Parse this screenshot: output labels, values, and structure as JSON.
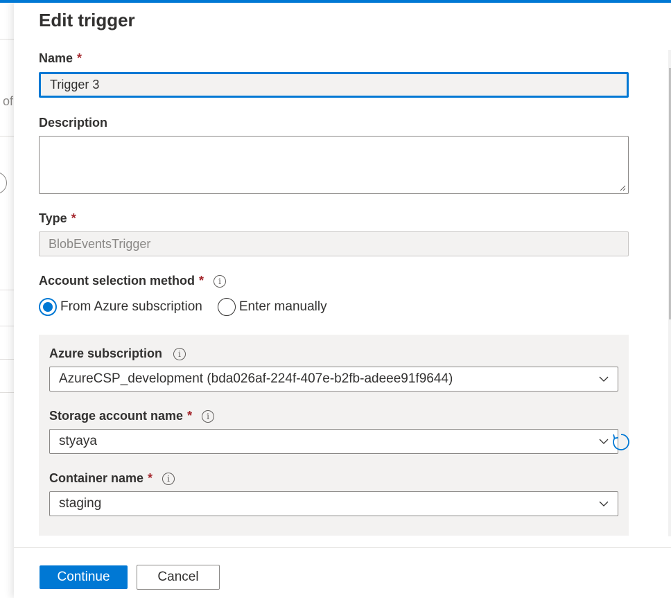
{
  "background": {
    "partial_text": "of"
  },
  "panel": {
    "title": "Edit trigger",
    "required_marker": "*",
    "fields": {
      "name": {
        "label": "Name",
        "value": "Trigger 3"
      },
      "description": {
        "label": "Description",
        "value": ""
      },
      "type": {
        "label": "Type",
        "value": "BlobEventsTrigger"
      },
      "account_method": {
        "label": "Account selection method",
        "options": [
          {
            "label": "From Azure subscription",
            "selected": true
          },
          {
            "label": "Enter manually",
            "selected": false
          }
        ]
      },
      "azure_subscription": {
        "label": "Azure subscription",
        "value": "AzureCSP_development (bda026af-224f-407e-b2fb-adeee91f9644)"
      },
      "storage_account": {
        "label": "Storage account name",
        "value": "styaya"
      },
      "container": {
        "label": "Container name",
        "value": "staging"
      }
    },
    "info_glyph": "i",
    "icons": [
      "info-icon",
      "chevron-down-icon",
      "refresh-icon",
      "resize-handle-icon"
    ],
    "buttons": {
      "continue": "Continue",
      "cancel": "Cancel"
    }
  },
  "colors": {
    "accent": "#0078d4",
    "required": "#a4262c",
    "field_bg": "#f3f2f1",
    "border": "#8a8886"
  }
}
